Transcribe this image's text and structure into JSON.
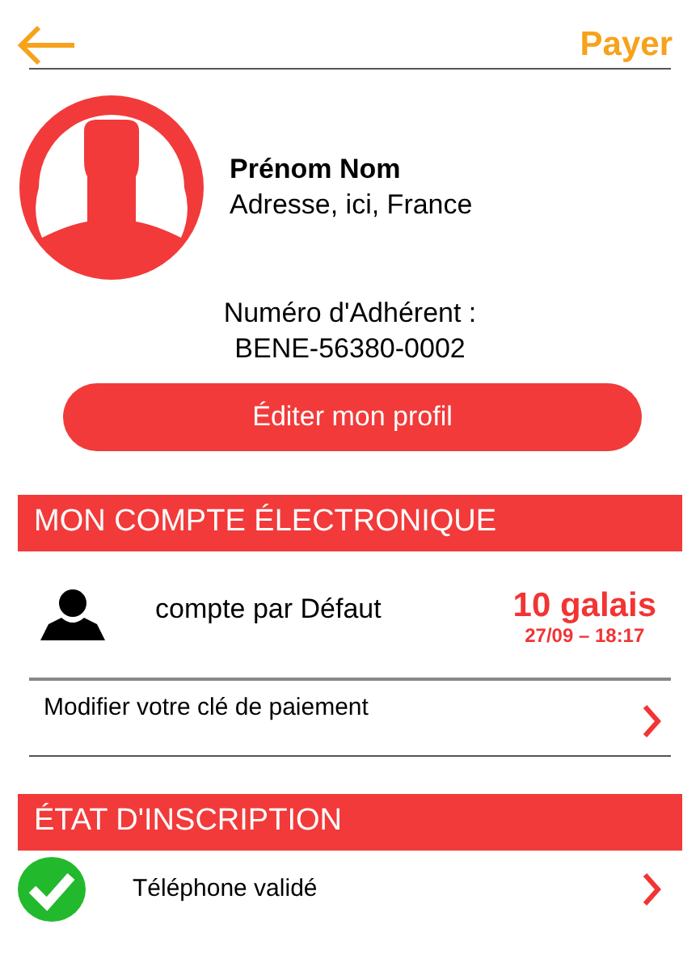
{
  "header": {
    "action": "Payer"
  },
  "profile": {
    "name": "Prénom Nom",
    "address": "Adresse, ici, France",
    "member_label": "Numéro d'Adhérent :",
    "member_number": "BENE-56380-0002",
    "edit_button": "Éditer mon profil"
  },
  "account_section": {
    "title": "MON COMPTE ÉLECTRONIQUE",
    "account": {
      "name": "compte par Défaut",
      "balance": "10 galais",
      "date": "27/09 – 18:17"
    },
    "link": "Modifier votre clé de paiement"
  },
  "registration_section": {
    "title": "ÉTAT D'INSCRIPTION",
    "items": [
      {
        "label": "Téléphone validé",
        "validated": true
      }
    ]
  }
}
